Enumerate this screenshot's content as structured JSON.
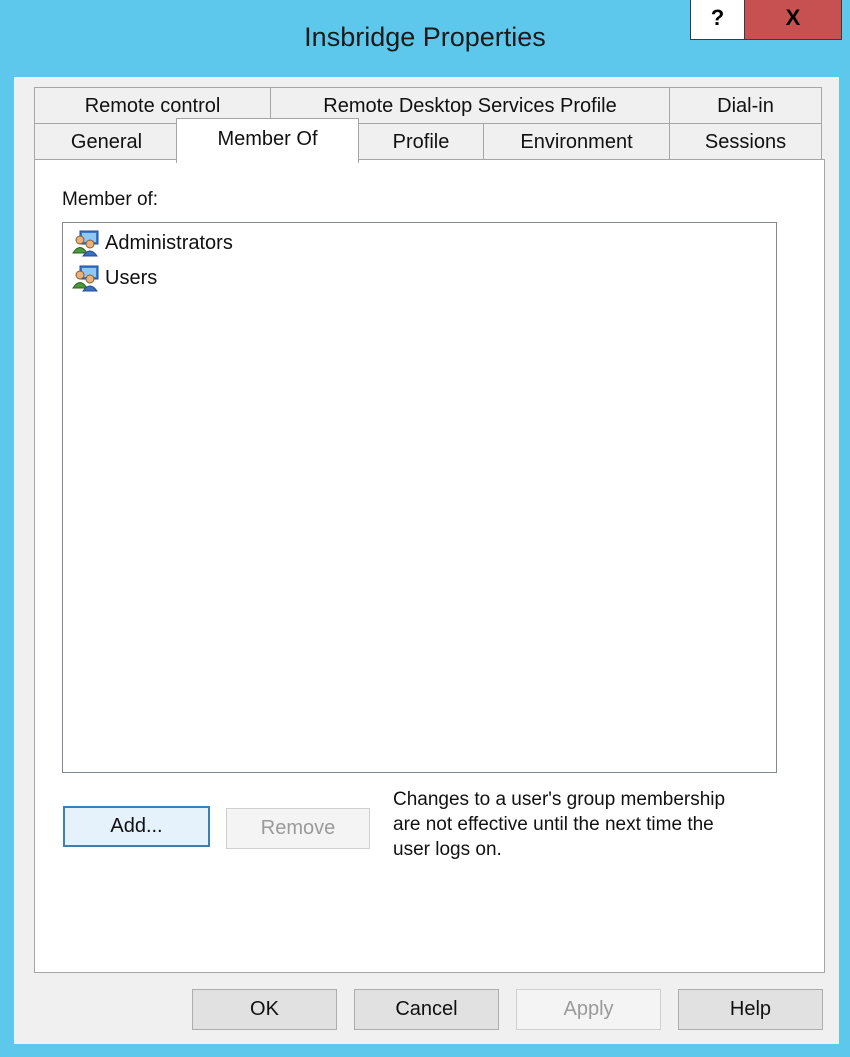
{
  "window": {
    "title": "Insbridge Properties",
    "help_label": "?",
    "close_label": "X"
  },
  "tabs_row1": [
    {
      "label": "Remote control"
    },
    {
      "label": "Remote Desktop Services Profile"
    },
    {
      "label": "Dial-in"
    }
  ],
  "tabs_row2": [
    {
      "label": "General"
    },
    {
      "label": "Member Of",
      "active": true
    },
    {
      "label": "Profile"
    },
    {
      "label": "Environment"
    },
    {
      "label": "Sessions"
    }
  ],
  "member_of": {
    "label": "Member of:",
    "items": [
      {
        "name": "Administrators",
        "icon": "group-icon"
      },
      {
        "name": "Users",
        "icon": "group-icon"
      }
    ]
  },
  "actions": {
    "add_label": "Add...",
    "remove_label": "Remove",
    "note_lines": [
      "Changes to a user's group membership",
      "are not effective until the next time the",
      "user logs on."
    ]
  },
  "footer": {
    "ok_label": "OK",
    "cancel_label": "Cancel",
    "apply_label": "Apply",
    "help_label": "Help"
  },
  "colors": {
    "titlebar": "#5ec8ec",
    "close_button": "#c75050",
    "default_button_border": "#3c7fb1"
  }
}
